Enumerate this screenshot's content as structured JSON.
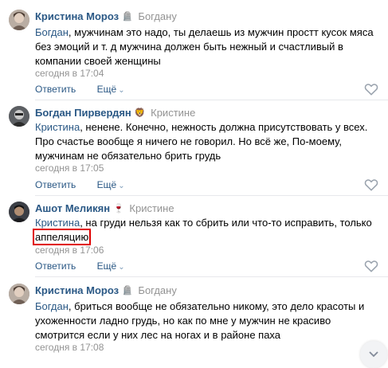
{
  "comments": [
    {
      "author": "Кристина Мороз",
      "badge": "🪦",
      "reply_to": "Богдану",
      "mention": "Богдан",
      "text": ", мужчинам это надо, ты делаешь из мужчин простт кусок мяса без эмоций и т. д мужчина должен быть нежный и счастливый в компании своей женщины",
      "time": "сегодня в 17:04",
      "reply_label": "Ответить",
      "more_label": "Ещё"
    },
    {
      "author": "Богдан Пирвердян",
      "badge": "🦁",
      "reply_to": "Кристине",
      "mention": "Кристина",
      "text": ", ненене. Конечно, нежность должна присутствовать у всех. Про счастье вообще я ничего не говорил. Но всё же, По-моему, мужчинам не обязательно брить грудь",
      "time": "сегодня в 17:05",
      "reply_label": "Ответить",
      "more_label": "Ещё"
    },
    {
      "author": "Ашот Меликян",
      "badge": "🍷",
      "reply_to": "Кристине",
      "mention": "Кристина",
      "text": ", на груди нельзя как то сбрить или что-то исправить, только",
      "highlight_word": "аппеляцию",
      "time": "сегодня в 17:06",
      "reply_label": "Ответить",
      "more_label": "Ещё"
    },
    {
      "author": "Кристина Мороз",
      "badge": "🪦",
      "reply_to": "Богдану",
      "mention": "Богдан",
      "text": ", бриться вообще не обязательно никому, это дело красоты и ухоженности ладно грудь, но как по мне у мужчин не красиво смотрится если у них лес на ногах и в районе паха",
      "time": "сегодня в 17:08",
      "reply_label": "Ответить",
      "more_label": "Ещё"
    }
  ],
  "colors": {
    "link": "#2a5885",
    "meta": "#939393",
    "highlight_box": "#e00000",
    "separator": "#e7e8ec"
  },
  "icons": {
    "like": "heart-icon",
    "more_chevron": "chevron-down-icon",
    "scroll": "arrow-down-icon"
  }
}
